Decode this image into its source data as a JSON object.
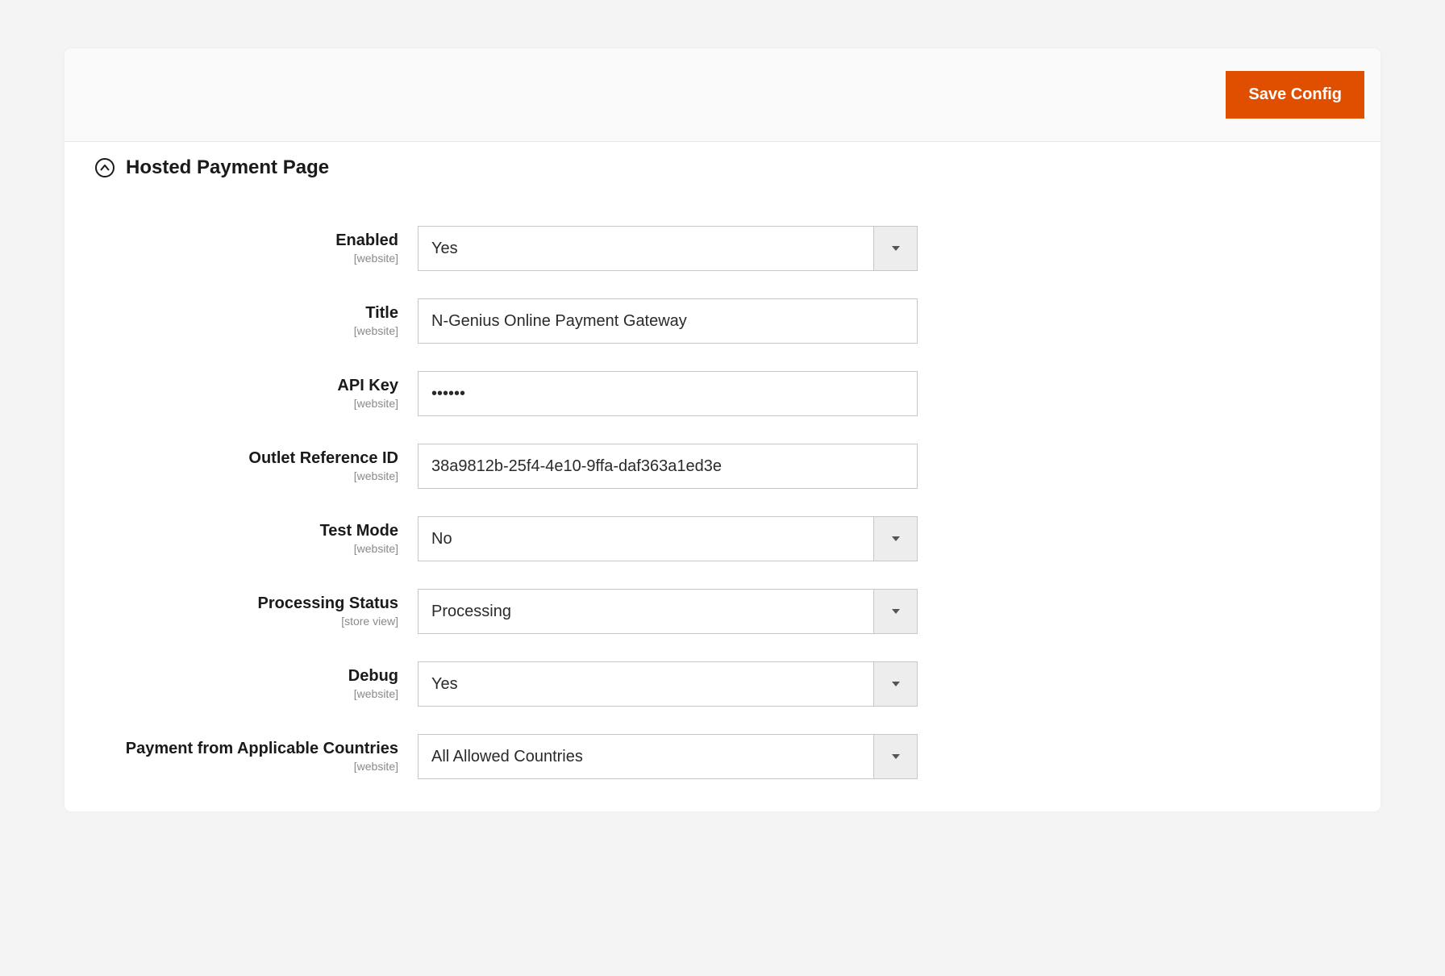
{
  "header": {
    "save_label": "Save Config"
  },
  "section": {
    "title": "Hosted Payment Page"
  },
  "scope": {
    "website": "[website]",
    "store_view": "[store view]"
  },
  "fields": {
    "enabled": {
      "label": "Enabled",
      "value": "Yes",
      "scope": "website"
    },
    "title": {
      "label": "Title",
      "value": "N-Genius Online Payment Gateway",
      "scope": "website"
    },
    "api_key": {
      "label": "API Key",
      "value": "••••••",
      "scope": "website"
    },
    "outlet": {
      "label": "Outlet Reference ID",
      "value": "38a9812b-25f4-4e10-9ffa-daf363a1ed3e",
      "scope": "website"
    },
    "test_mode": {
      "label": "Test Mode",
      "value": "No",
      "scope": "website"
    },
    "processing": {
      "label": "Processing Status",
      "value": "Processing",
      "scope": "store_view"
    },
    "debug": {
      "label": "Debug",
      "value": "Yes",
      "scope": "website"
    },
    "countries": {
      "label": "Payment from Applicable Countries",
      "value": "All Allowed Countries",
      "scope": "website"
    }
  }
}
